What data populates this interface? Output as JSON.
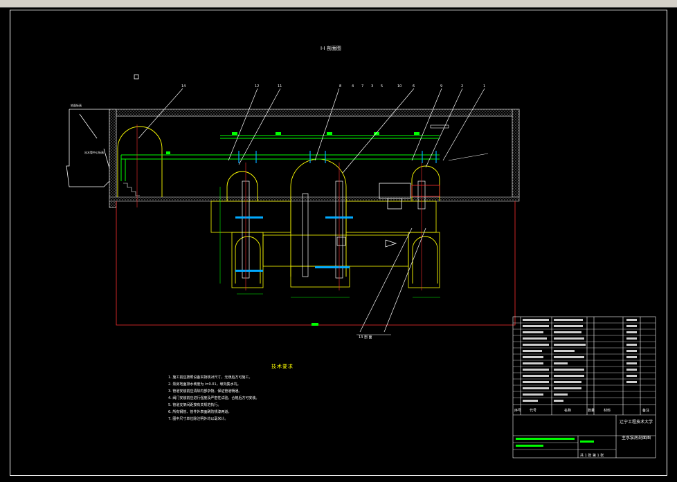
{
  "colors": {
    "background": "#000000",
    "frame": "#ffffff",
    "wall": "#ffff00",
    "hatch": "#c8c8c8",
    "pipe": "#00ff00",
    "leader": "#ffffff",
    "axis": "#ff3030",
    "valve": "#00aaff"
  },
  "drawing": {
    "title": "I-I 剖面图",
    "section_label": "13 剖 面",
    "left_labels": [
      "地面标高",
      "出水管中心标高"
    ],
    "leader_numbers": [
      "14",
      "12",
      "11",
      "8",
      "4",
      "7",
      "3",
      "5",
      "10",
      "6",
      "9",
      "2",
      "1"
    ]
  },
  "notes": {
    "title": "技术要求",
    "lines": [
      "1. 施工前应按照设备实物核对尺寸，无误后方可施工。",
      "2. 泵房地面排水坡度为 i=0.01，坡向集水坑。",
      "3. 管道安装前应清除内部杂物，保证管道畅通。",
      "4. 阀门安装前应进行强度及严密性试验，合格后方可安装。",
      "5. 管道支架间距按有关规范执行。",
      "6. 所有钢管、管件外表面刷防锈漆两道。",
      "7. 图中尺寸单位除注明外均以毫米计。"
    ]
  },
  "title_block": {
    "school": "辽宁工程技术大学",
    "drawing_name": "主水泵房剖面图",
    "headers": [
      "序号",
      "代号",
      "名称",
      "数量",
      "材料",
      "备注"
    ],
    "page_info": "共 1 张  第 1 张"
  }
}
